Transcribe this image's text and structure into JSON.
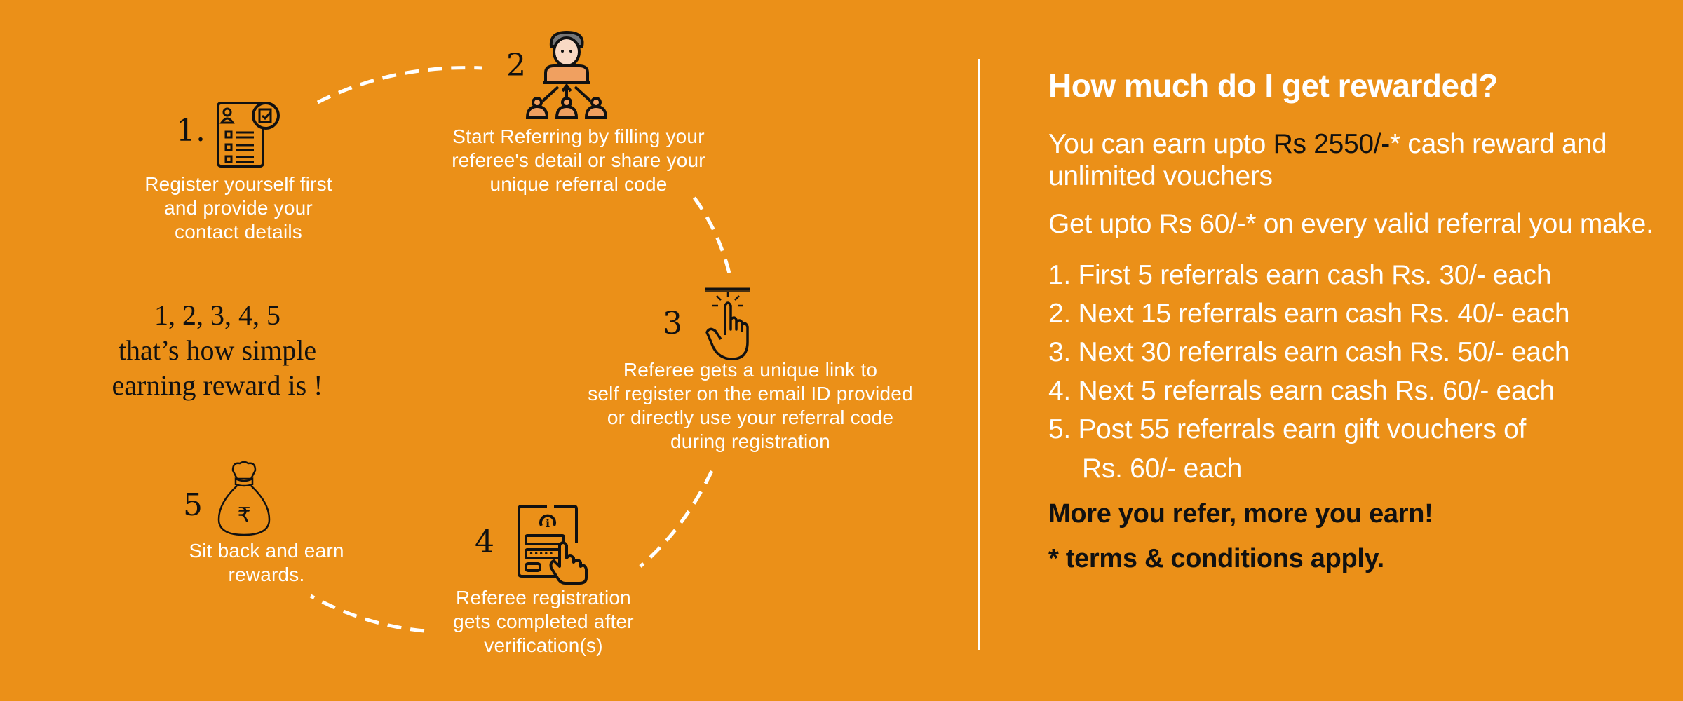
{
  "colors": {
    "background": "#EB9018",
    "text_light": "#FFFFFF",
    "text_dark": "#111111"
  },
  "steps": [
    {
      "number": "1.",
      "icon": "registration-form-icon",
      "text": [
        "Register yourself first",
        "and provide your",
        "contact details"
      ]
    },
    {
      "number": "2",
      "icon": "referral-network-icon",
      "text": [
        "Start Referring by filling your",
        "referee's detail or share your",
        "unique referral code"
      ]
    },
    {
      "number": "3",
      "icon": "tap-hand-icon",
      "text": [
        "Referee gets a unique link to",
        "self register on the email ID provided",
        "or directly use your referral code",
        "during registration"
      ]
    },
    {
      "number": "4",
      "icon": "signup-form-icon",
      "text": [
        "Referee registration",
        "gets completed after",
        "verification(s)"
      ]
    },
    {
      "number": "5",
      "icon": "rupee-money-bag-icon",
      "text": [
        "Sit back and earn",
        "rewards."
      ]
    }
  ],
  "tagline": [
    "1, 2, 3, 4, 5",
    "that’s how simple",
    "earning reward is !"
  ],
  "rewards": {
    "title": "How much do I get rewarded?",
    "intro_prefix": "You can earn upto ",
    "intro_highlight": "Rs 2550/-",
    "intro_suffix": "* cash reward and unlimited vouchers",
    "per_referral": "Get upto Rs 60/-* on every valid referral you make.",
    "tiers": [
      {
        "label": "1. First 5 referrals earn cash Rs. 30/- each"
      },
      {
        "label": "2. Next 15 referrals earn cash Rs. 40/- each"
      },
      {
        "label": "3. Next 30 referrals earn cash Rs. 50/- each"
      },
      {
        "label": "4. Next 5 referrals earn cash Rs. 60/- each"
      },
      {
        "label": "5. Post 55 referrals earn gift vouchers of",
        "continuation": "Rs. 60/- each"
      }
    ],
    "motto": "More you refer, more you earn!",
    "terms": "* terms & conditions apply."
  }
}
